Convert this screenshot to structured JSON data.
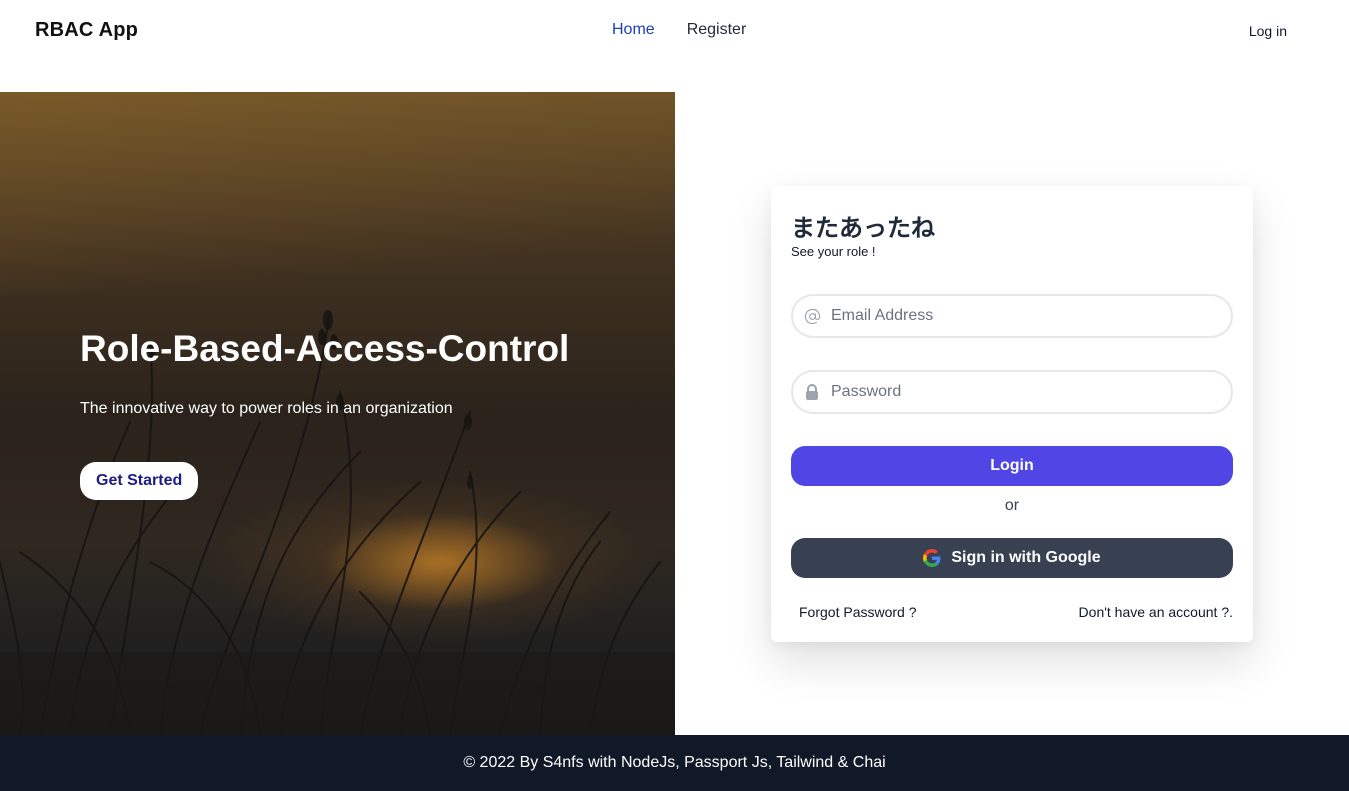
{
  "header": {
    "brand": "RBAC App",
    "nav": [
      {
        "label": "Home"
      },
      {
        "label": "Register"
      }
    ],
    "login_label": "Log in"
  },
  "hero": {
    "title": "Role-Based-Access-Control",
    "subtitle": "The innovative way to power roles in an organization",
    "cta_label": "Get Started"
  },
  "login_card": {
    "title": "またあったね",
    "subtitle": "See your role !",
    "email_placeholder": "Email Address",
    "password_placeholder": "Password",
    "email_icon": "at-icon",
    "password_icon": "lock-icon",
    "login_label": "Login",
    "or_text": "or",
    "google_label": "Sign in with Google",
    "forgot_label": "Forgot Password ?",
    "signup_label": "Don't have an account ?."
  },
  "footer": {
    "text": "© 2022 By S4nfs with NodeJs, Passport Js, Tailwind & Chai"
  },
  "colors": {
    "nav_active": "#1e40af",
    "primary_button": "#4f46e5",
    "google_button": "#374151",
    "footer_bg": "#111827",
    "cta_text": "#1e1b87"
  }
}
